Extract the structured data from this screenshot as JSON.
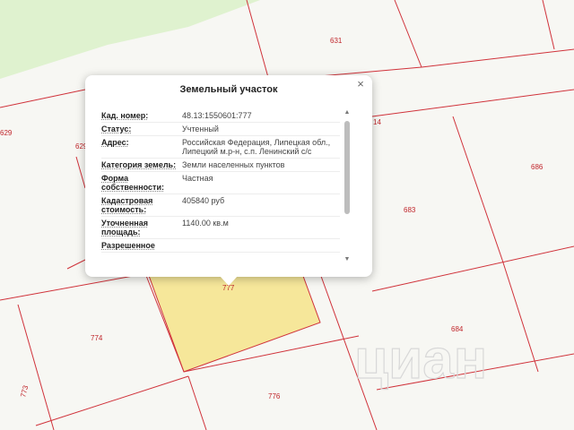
{
  "map": {
    "parcel_numbers": [
      "631",
      "629",
      "629",
      "14",
      "686",
      "683",
      "684",
      "774",
      "773",
      "776",
      "777"
    ],
    "watermark_text": "циан",
    "parcel_line_color": "#d0323a",
    "highlight_fill": "#f6e79a",
    "park_color": "#dff2cf"
  },
  "popup": {
    "title": "Земельный участок",
    "close_label": "×",
    "rows": [
      {
        "label": "Кад. номер:",
        "value": "48.13:1550601:777"
      },
      {
        "label": "Статус:",
        "value": "Учтенный"
      },
      {
        "label": "Адрес:",
        "value": "Российская Федерация, Липецкая обл., Липецкий м.р-н, с.п. Ленинский с/с"
      },
      {
        "label": "Категория земель:",
        "value": "Земли населенных пунктов"
      },
      {
        "label": "Форма собственности:",
        "value": "Частная"
      },
      {
        "label": "Кадастровая стоимость:",
        "value": "405840 руб"
      },
      {
        "label": "Уточненная площадь:",
        "value": "1140.00 кв.м"
      },
      {
        "label": "Разрешенное",
        "value": ""
      }
    ],
    "scroll_up": "▲",
    "scroll_down": "▼"
  }
}
